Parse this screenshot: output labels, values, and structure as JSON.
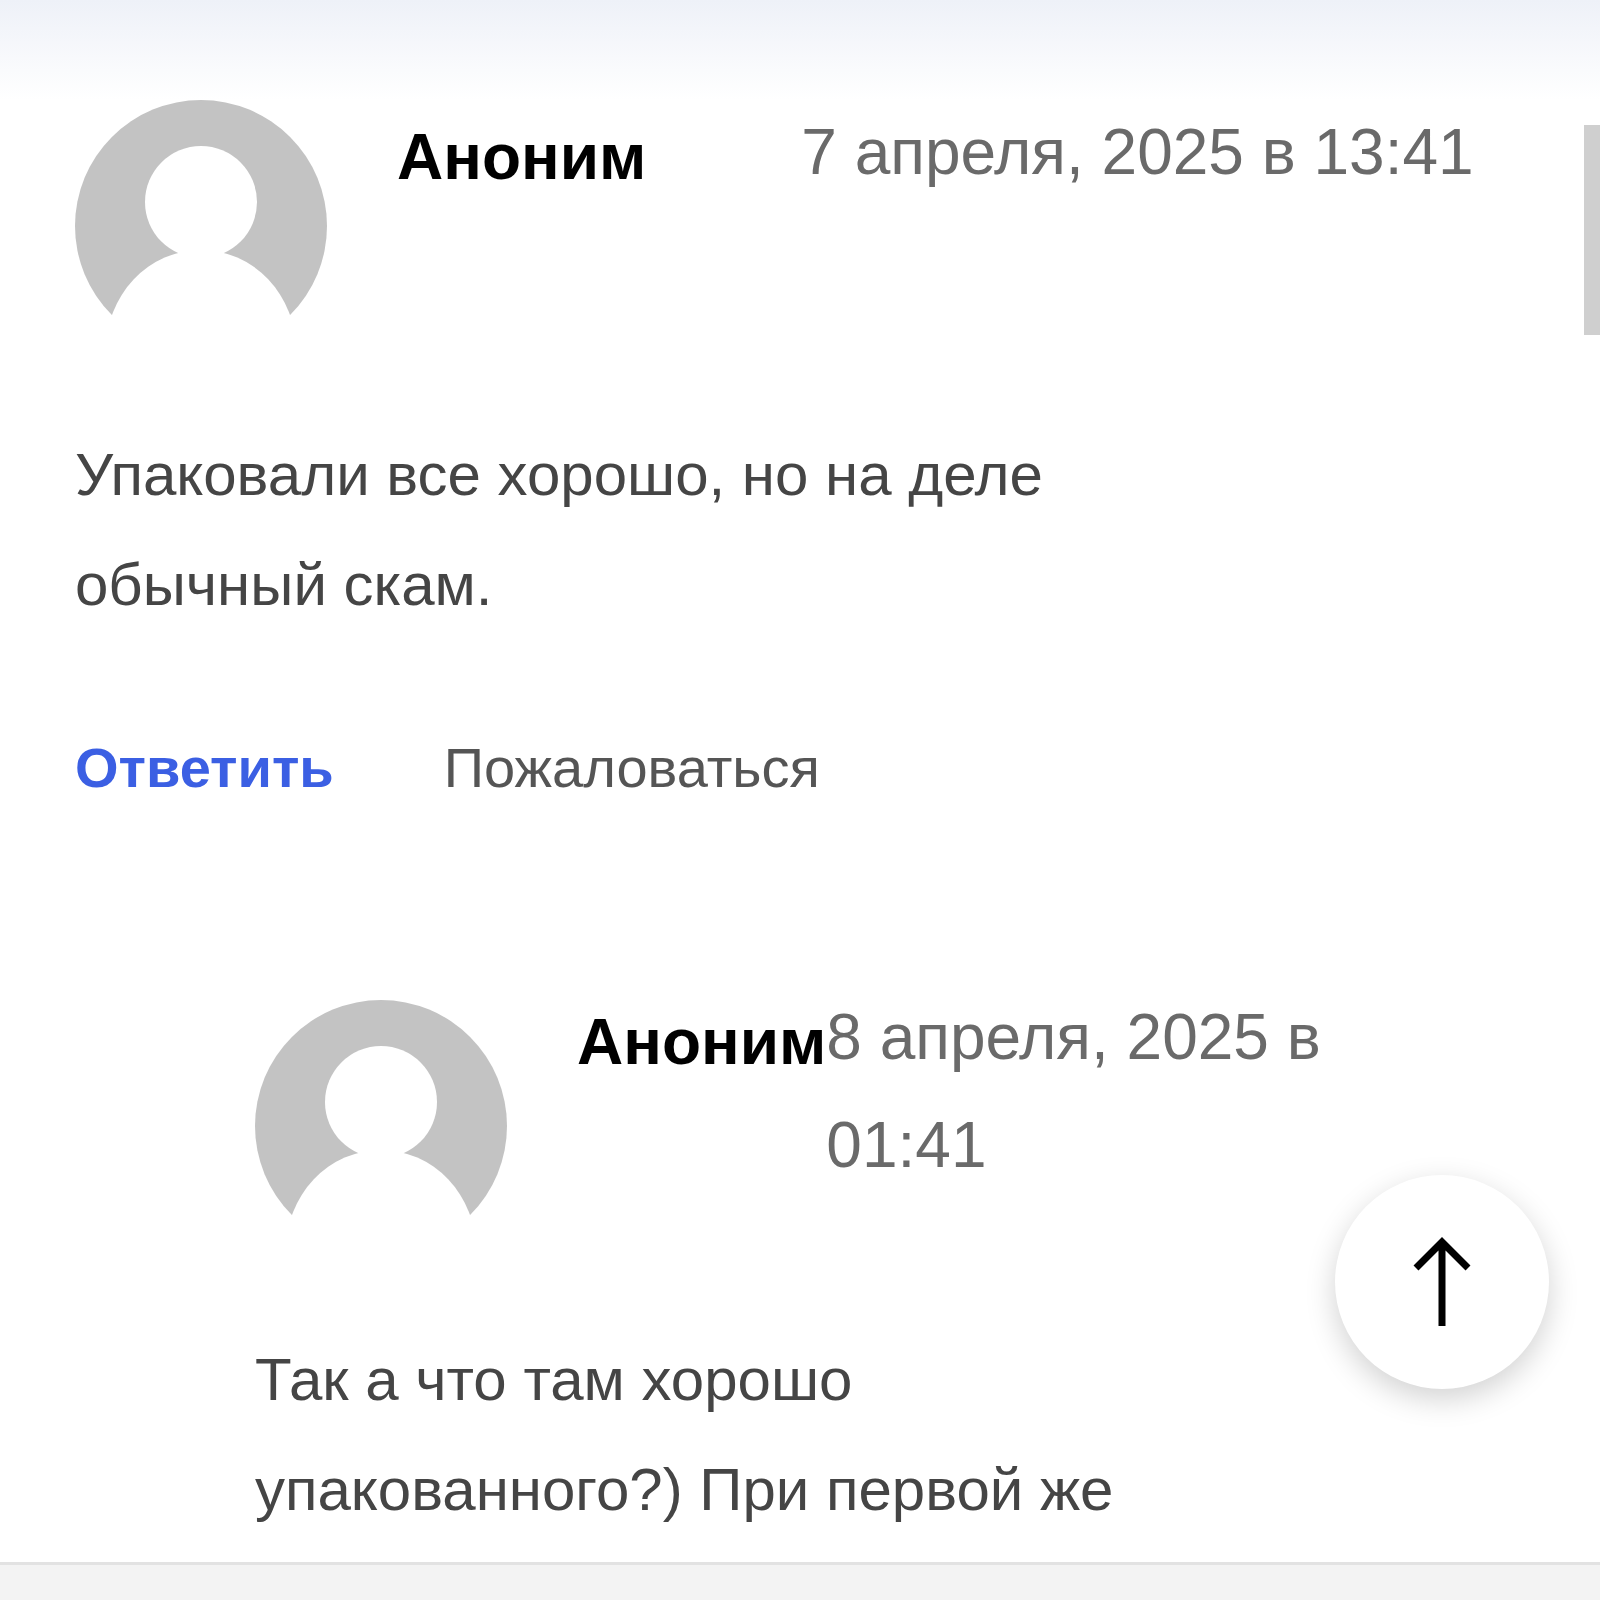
{
  "comments": [
    {
      "author": "Аноним",
      "date": "7 апреля, 2025 в 13:41",
      "text": "Упаковали все хорошо, но на деле обычный скам.",
      "actions": [
        {
          "label": "Ответить",
          "kind": "reply"
        },
        {
          "label": "Пожаловаться",
          "kind": "report"
        }
      ],
      "children": [
        {
          "author": "Аноним",
          "date": "8 апреля, 2025 в 01:41",
          "text": "Так а что там хорошо упакованного?) При первой же"
        }
      ]
    }
  ]
}
